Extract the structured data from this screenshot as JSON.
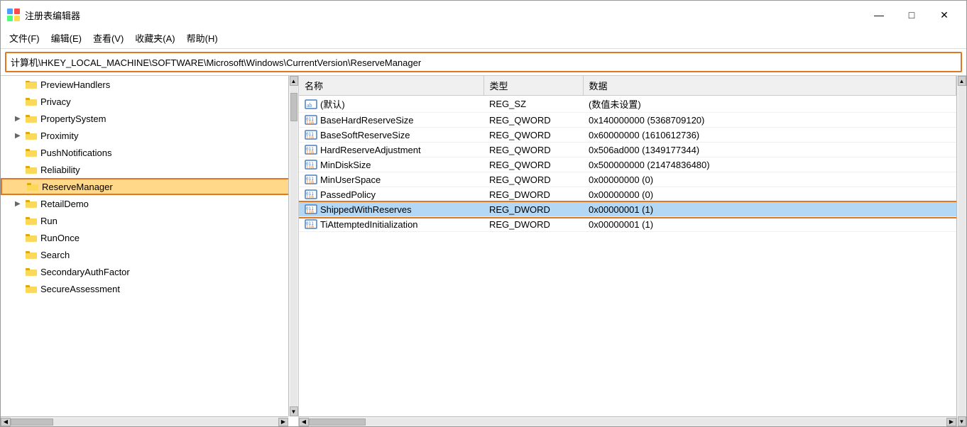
{
  "window": {
    "title": "注册表编辑器",
    "minimize": "—",
    "maximize": "□",
    "close": "✕"
  },
  "menu": {
    "items": [
      "文件(F)",
      "编辑(E)",
      "查看(V)",
      "收藏夹(A)",
      "帮助(H)"
    ]
  },
  "address": {
    "path": "计算机\\HKEY_LOCAL_MACHINE\\SOFTWARE\\Microsoft\\Windows\\CurrentVersion\\ReserveManager"
  },
  "tree": {
    "items": [
      {
        "label": "PreviewHandlers",
        "indent": 1,
        "expandable": false,
        "selected": false
      },
      {
        "label": "Privacy",
        "indent": 1,
        "expandable": false,
        "selected": false
      },
      {
        "label": "PropertySystem",
        "indent": 1,
        "expandable": true,
        "selected": false
      },
      {
        "label": "Proximity",
        "indent": 1,
        "expandable": true,
        "selected": false
      },
      {
        "label": "PushNotifications",
        "indent": 1,
        "expandable": false,
        "selected": false
      },
      {
        "label": "Reliability",
        "indent": 1,
        "expandable": false,
        "selected": false
      },
      {
        "label": "ReserveManager",
        "indent": 1,
        "expandable": false,
        "selected": true
      },
      {
        "label": "RetailDemo",
        "indent": 1,
        "expandable": true,
        "selected": false
      },
      {
        "label": "Run",
        "indent": 1,
        "expandable": false,
        "selected": false
      },
      {
        "label": "RunOnce",
        "indent": 1,
        "expandable": false,
        "selected": false
      },
      {
        "label": "Search",
        "indent": 1,
        "expandable": false,
        "selected": false
      },
      {
        "label": "SecondaryAuthFactor",
        "indent": 1,
        "expandable": false,
        "selected": false
      },
      {
        "label": "SecureAssessment",
        "indent": 1,
        "expandable": false,
        "selected": false
      }
    ]
  },
  "registry": {
    "columns": [
      "名称",
      "类型",
      "数据"
    ],
    "rows": [
      {
        "name": "(默认)",
        "type": "REG_SZ",
        "data": "(数值未设置)",
        "icon": "ab",
        "selected": false
      },
      {
        "name": "BaseHardReserveSize",
        "type": "REG_QWORD",
        "data": "0x140000000 (5368709120)",
        "icon": "bin",
        "selected": false
      },
      {
        "name": "BaseSoftReserveSize",
        "type": "REG_QWORD",
        "data": "0x60000000 (1610612736)",
        "icon": "bin",
        "selected": false
      },
      {
        "name": "HardReserveAdjustment",
        "type": "REG_QWORD",
        "data": "0x506ad000 (1349177344)",
        "icon": "bin",
        "selected": false
      },
      {
        "name": "MinDiskSize",
        "type": "REG_QWORD",
        "data": "0x500000000 (21474836480)",
        "icon": "bin",
        "selected": false
      },
      {
        "name": "MinUserSpace",
        "type": "REG_QWORD",
        "data": "0x00000000 (0)",
        "icon": "bin",
        "selected": false
      },
      {
        "name": "PassedPolicy",
        "type": "REG_DWORD",
        "data": "0x00000000 (0)",
        "icon": "bin",
        "selected": false
      },
      {
        "name": "ShippedWithReserves",
        "type": "REG_DWORD",
        "data": "0x00000001 (1)",
        "icon": "bin",
        "selected": true
      },
      {
        "name": "TiAttemptedInitialization",
        "type": "REG_DWORD",
        "data": "0x00000001 (1)",
        "icon": "bin",
        "selected": false
      }
    ]
  }
}
